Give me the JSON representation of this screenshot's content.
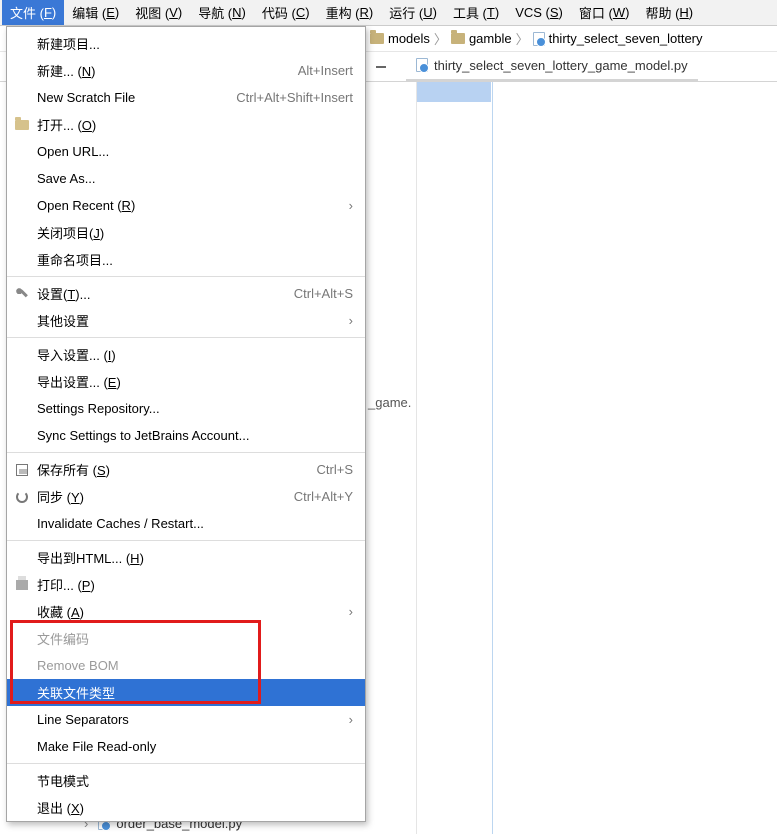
{
  "menubar": {
    "items": [
      {
        "prefix": "文件 (",
        "mn": "F",
        "suffix": ")"
      },
      {
        "prefix": "编辑 (",
        "mn": "E",
        "suffix": ")"
      },
      {
        "prefix": "视图 (",
        "mn": "V",
        "suffix": ")"
      },
      {
        "prefix": "导航 (",
        "mn": "N",
        "suffix": ")"
      },
      {
        "prefix": "代码 (",
        "mn": "C",
        "suffix": ")"
      },
      {
        "prefix": "重构 (",
        "mn": "R",
        "suffix": ")"
      },
      {
        "prefix": "运行 (",
        "mn": "U",
        "suffix": ")"
      },
      {
        "prefix": "工具 (",
        "mn": "T",
        "suffix": ")"
      },
      {
        "prefix": "VCS (",
        "mn": "S",
        "suffix": ")"
      },
      {
        "prefix": "窗口 (",
        "mn": "W",
        "suffix": ")"
      },
      {
        "prefix": "帮助 (",
        "mn": "H",
        "suffix": ")"
      }
    ]
  },
  "breadcrumb": {
    "items": [
      "models",
      "gamble",
      "thirty_select_seven_lottery"
    ]
  },
  "tab": {
    "label": "thirty_select_seven_lottery_game_model.py"
  },
  "dropdown": {
    "groups": [
      [
        {
          "label": "新建项目...",
          "shortcut": ""
        },
        {
          "label_pre": "新建... (",
          "mn": "N",
          "label_post": ")",
          "shortcut": "Alt+Insert"
        },
        {
          "label": "New Scratch File",
          "shortcut": "Ctrl+Alt+Shift+Insert"
        },
        {
          "label_pre": "打开... (",
          "mn": "O",
          "label_post": ")",
          "icon": "open"
        },
        {
          "label": "Open URL..."
        },
        {
          "label": "Save As..."
        },
        {
          "label_pre": "Open Recent (",
          "mn": "R",
          "label_post": ")",
          "submenu": true
        },
        {
          "label_pre": "关闭项目(",
          "mn": "J",
          "label_post": ")"
        },
        {
          "label": "重命名项目..."
        }
      ],
      [
        {
          "label_pre": "设置(",
          "mn": "T",
          "label_post": ")...",
          "shortcut": "Ctrl+Alt+S",
          "icon": "wrench"
        },
        {
          "label": "其他设置",
          "submenu": true
        }
      ],
      [
        {
          "label_pre": "导入设置... (",
          "mn": "I",
          "label_post": ")"
        },
        {
          "label_pre": "导出设置... (",
          "mn": "E",
          "label_post": ")"
        },
        {
          "label": "Settings Repository..."
        },
        {
          "label": "Sync Settings to JetBrains Account..."
        }
      ],
      [
        {
          "label_pre": "保存所有 (",
          "mn": "S",
          "label_post": ")",
          "shortcut": "Ctrl+S",
          "icon": "disk"
        },
        {
          "label_pre": "同步 (",
          "mn": "Y",
          "label_post": ")",
          "shortcut": "Ctrl+Alt+Y",
          "icon": "sync"
        },
        {
          "label": "Invalidate Caches / Restart..."
        }
      ],
      [
        {
          "label_pre": "导出到HTML... (",
          "mn": "H",
          "label_post": ")"
        },
        {
          "label_pre": "打印... (",
          "mn": "P",
          "label_post": ")",
          "icon": "print"
        },
        {
          "label_pre": "收藏 (",
          "mn": "A",
          "label_post": ")",
          "submenu": true
        },
        {
          "label": "文件编码",
          "disabled": true
        },
        {
          "label": "Remove BOM",
          "disabled": true
        },
        {
          "label": "关联文件类型",
          "highlight": true
        },
        {
          "label": "Line Separators",
          "submenu": true
        },
        {
          "label": "Make File Read-only"
        }
      ],
      [
        {
          "label": "节电模式"
        },
        {
          "label_pre": "退出 (",
          "mn": "X",
          "label_post": ")"
        }
      ]
    ]
  },
  "cut_text": "_game.",
  "tree": {
    "rows": [
      "lottery_game_base.py",
      "order_base_model.py"
    ]
  }
}
